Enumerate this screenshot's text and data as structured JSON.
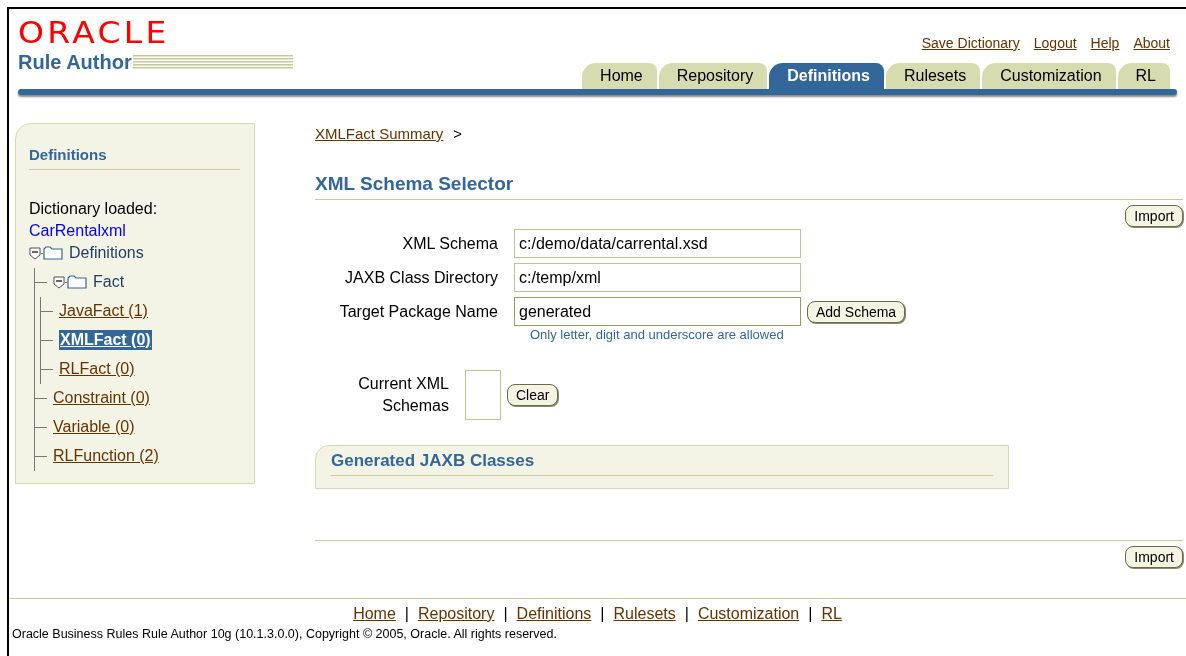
{
  "header": {
    "logo": "ORACLE",
    "product": "Rule Author",
    "global_links": [
      "Save Dictionary",
      "Logout",
      "Help",
      "About"
    ]
  },
  "tabs": [
    {
      "label": "Home",
      "selected": false
    },
    {
      "label": "Repository",
      "selected": false
    },
    {
      "label": "Definitions",
      "selected": true
    },
    {
      "label": "Rulesets",
      "selected": false
    },
    {
      "label": "Customization",
      "selected": false
    },
    {
      "label": "RL",
      "selected": false
    }
  ],
  "sidebar": {
    "title": "Definitions",
    "caption": "Dictionary loaded:",
    "dictionary": "CarRentalxml",
    "tree": [
      {
        "label": "Definitions",
        "kind": "folder",
        "expanded": true,
        "selected": false,
        "children": [
          {
            "label": "Fact",
            "kind": "folder",
            "expanded": true,
            "selected": false,
            "children": [
              {
                "label": "JavaFact (1)",
                "kind": "link",
                "selected": false
              },
              {
                "label": "XMLFact (0)",
                "kind": "link",
                "selected": true
              },
              {
                "label": "RLFact (0)",
                "kind": "link",
                "selected": false
              }
            ]
          },
          {
            "label": "Constraint (0)",
            "kind": "link",
            "selected": false
          },
          {
            "label": "Variable (0)",
            "kind": "link",
            "selected": false
          },
          {
            "label": "RLFunction (2)",
            "kind": "link",
            "selected": false
          }
        ]
      }
    ]
  },
  "breadcrumb": {
    "link": "XMLFact Summary",
    "separator": ">"
  },
  "page_title": "XML Schema Selector",
  "import_button": "Import",
  "form": {
    "fields": [
      {
        "label": "XML Schema",
        "value": "c:/demo/data/carrental.xsd"
      },
      {
        "label": "JAXB Class Directory",
        "value": "c:/temp/xml"
      },
      {
        "label": "Target Package Name",
        "value": "generated",
        "focused": true,
        "button": "Add Schema",
        "hint": "Only letter, digit and underscore are allowed"
      }
    ],
    "current_label": "Current XML Schemas",
    "clear_button": "Clear"
  },
  "generated_panel": {
    "title": "Generated JAXB Classes"
  },
  "bottom_import_button": "Import",
  "footer": {
    "links": [
      "Home",
      "Repository",
      "Definitions",
      "Rulesets",
      "Customization",
      "RL"
    ],
    "separator": "|",
    "copyright": "Oracle Business Rules Rule Author 10g (10.1.3.0.0), Copyright © 2005, Oracle. All rights reserved."
  }
}
